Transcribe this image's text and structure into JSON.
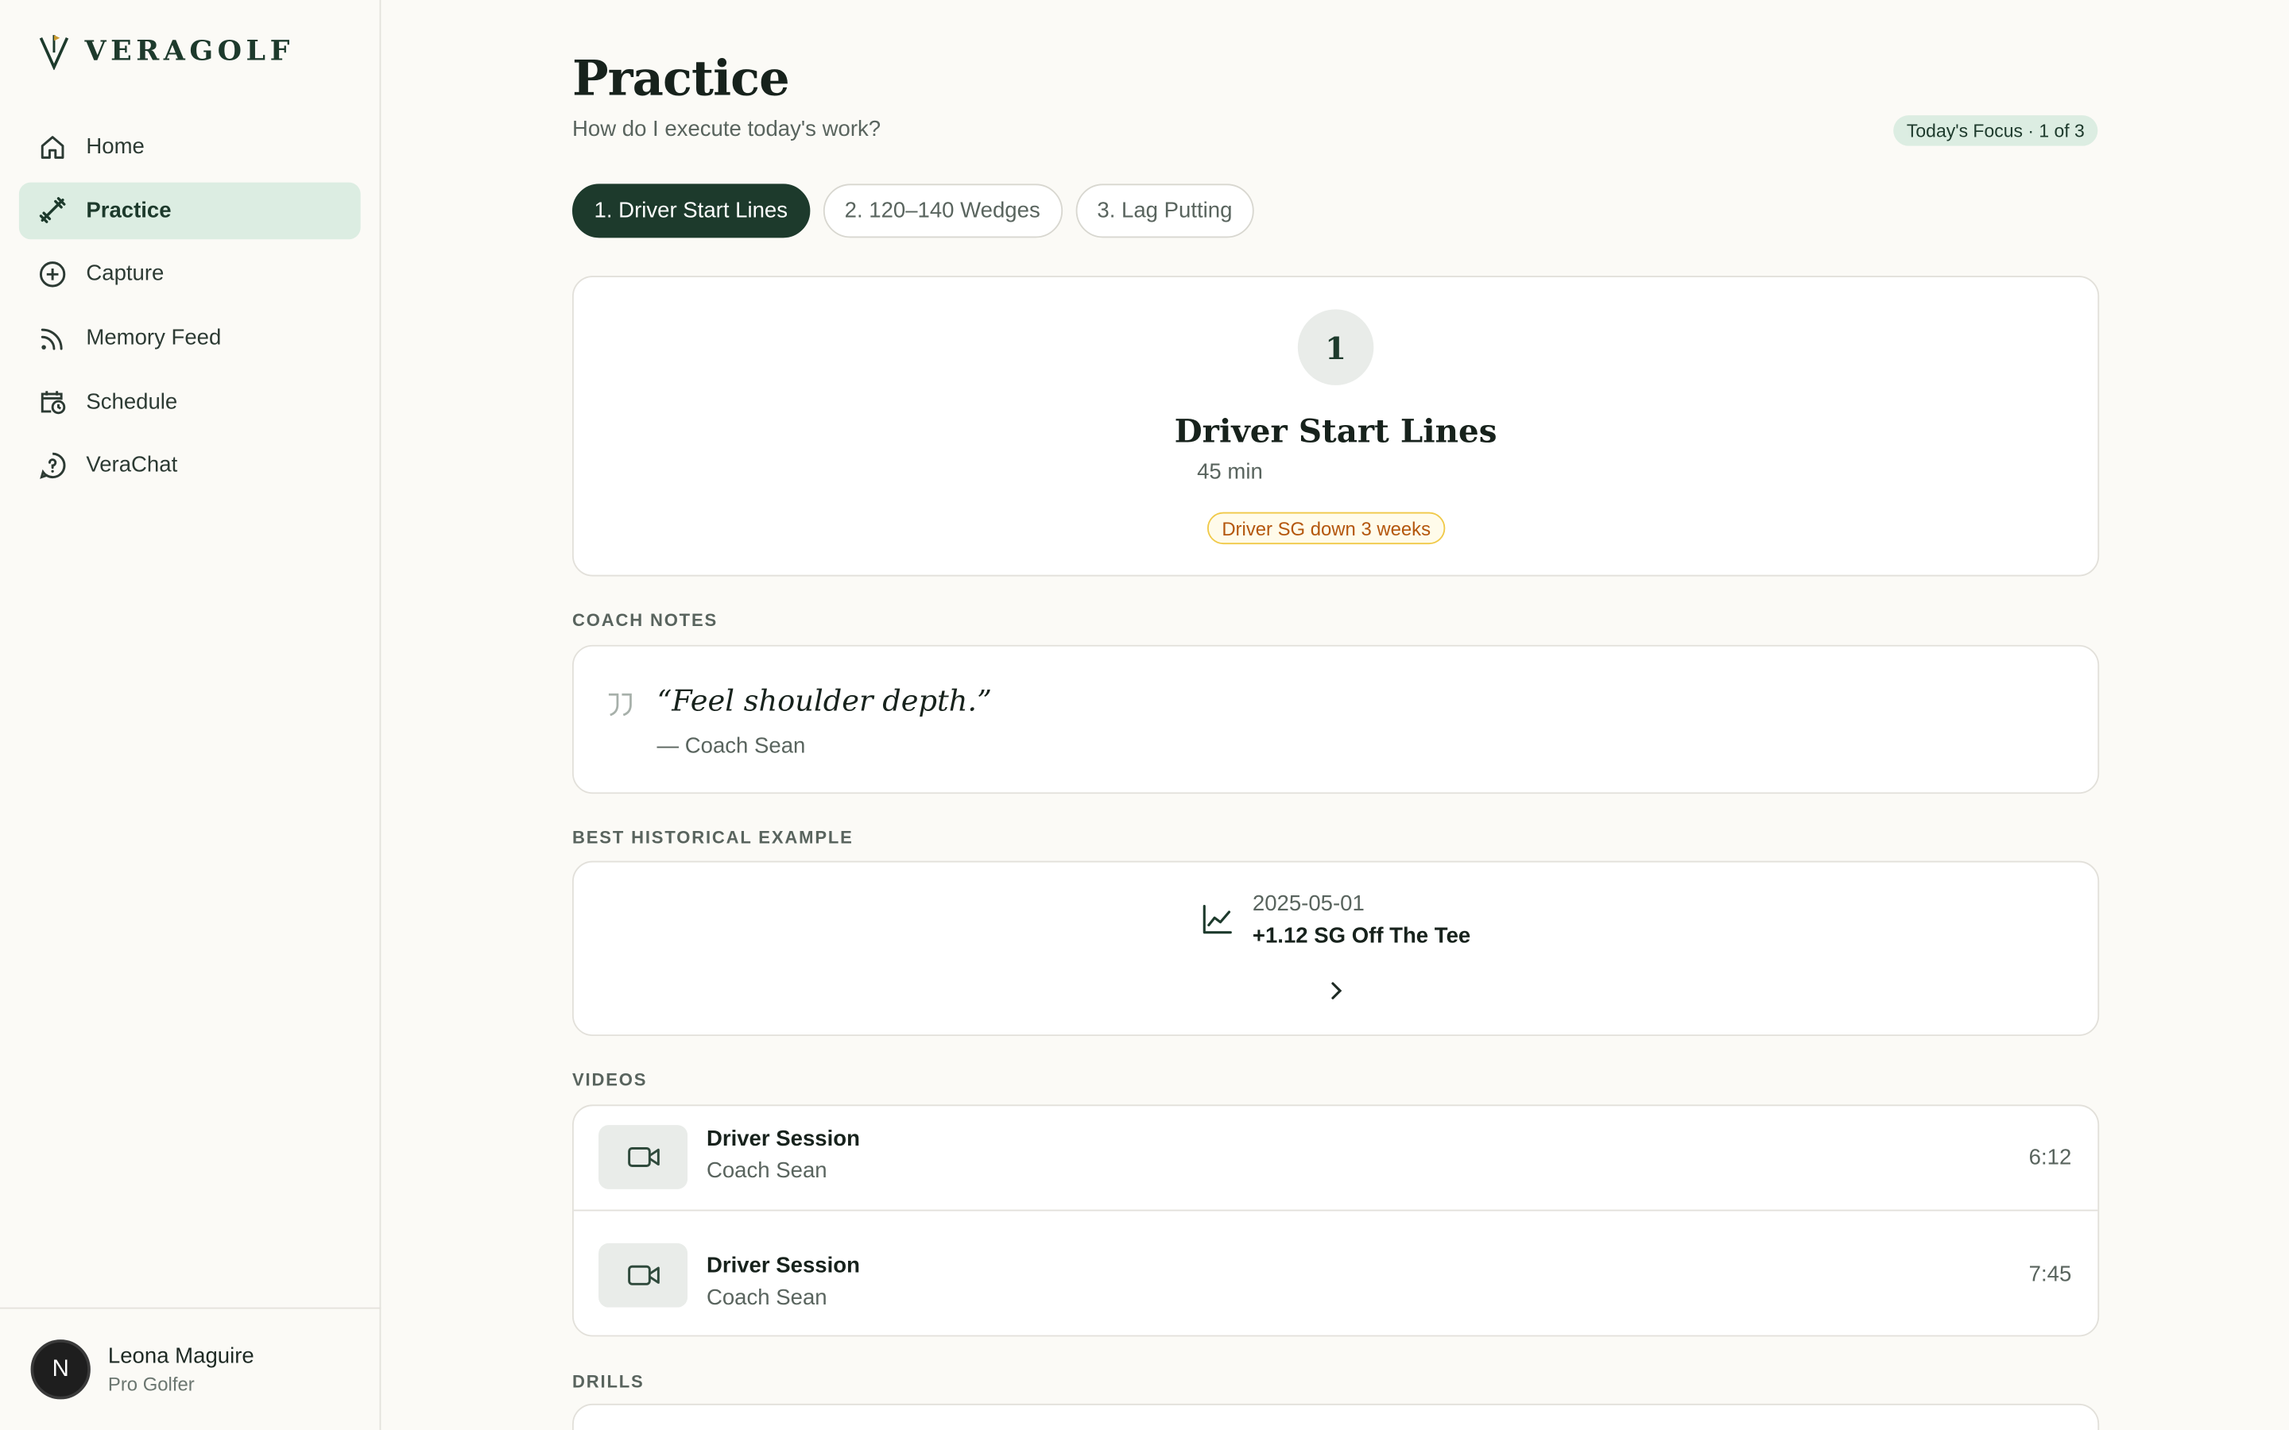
{
  "app": {
    "brand": "VERAGOLF"
  },
  "sidebar": {
    "items": [
      {
        "label": "Home",
        "icon": "home-icon"
      },
      {
        "label": "Practice",
        "icon": "dumbbell-icon",
        "active": true
      },
      {
        "label": "Capture",
        "icon": "plus-circle-icon"
      },
      {
        "label": "Memory Feed",
        "icon": "rss-icon"
      },
      {
        "label": "Schedule",
        "icon": "calendar-clock-icon"
      },
      {
        "label": "VeraChat",
        "icon": "help-chat-icon"
      }
    ],
    "user": {
      "initial": "N",
      "name": "Leona Maguire",
      "role": "Pro Golfer"
    }
  },
  "page": {
    "title": "Practice",
    "subtitle": "How do I execute today's work?",
    "focus_badge": "Today's Focus · 1 of 3"
  },
  "tabs": [
    {
      "label": "1. Driver Start Lines",
      "active": true
    },
    {
      "label": "2. 120–140 Wedges"
    },
    {
      "label": "3. Lag Putting"
    }
  ],
  "focus": {
    "number": "1",
    "name": "Driver Start Lines",
    "duration": "45 min",
    "alert": "Driver SG down 3 weeks"
  },
  "coach_notes": {
    "label": "COACH NOTES",
    "quote": "“Feel shoulder depth.”",
    "author": "— Coach Sean"
  },
  "history": {
    "label": "BEST HISTORICAL EXAMPLE",
    "date": "2025-05-01",
    "value": "+1.12 SG Off The Tee"
  },
  "videos": {
    "label": "VIDEOS",
    "items": [
      {
        "title": "Driver Session",
        "coach": "Coach Sean",
        "duration": "6:12"
      },
      {
        "title": "Driver Session",
        "coach": "Coach Sean",
        "duration": "7:45"
      }
    ]
  },
  "drills": {
    "label": "DRILLS"
  },
  "colors": {
    "accent": "#1d3a2c",
    "accent_soft": "#dcede2",
    "alert": "#b4570d"
  }
}
